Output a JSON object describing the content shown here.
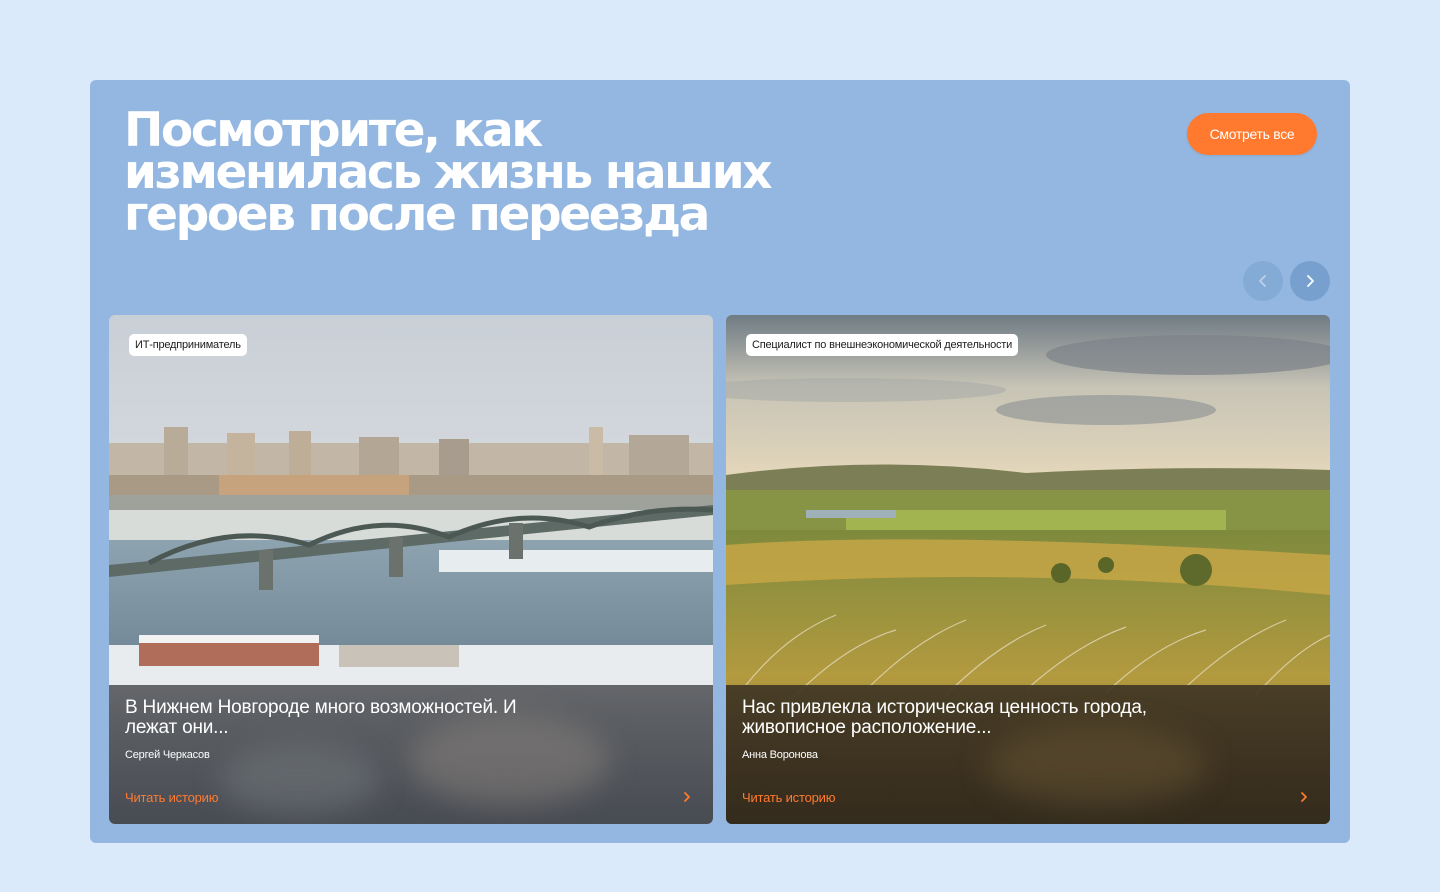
{
  "section": {
    "title": "Посмотрите, как изменилась жизнь наших героев после переезда",
    "see_all_label": "Смотреть все"
  },
  "carousel": {
    "prev_icon": "chevron-left-icon",
    "next_icon": "chevron-right-icon",
    "cards": [
      {
        "tag": "ИТ-предприниматель",
        "title": "В Нижнем Новгороде много возможностей. И лежат они...",
        "author": "Сергей Черкасов",
        "link_label": "Читать историю",
        "image": "city-bridge-winter-photo"
      },
      {
        "tag": "Специалист по внешнеэкономической деятельности",
        "title": "Нас привлекла историческая ценность города, живописное расположение...",
        "author": "Анна Воронова",
        "link_label": "Читать историю",
        "image": "steppe-landscape-photo"
      }
    ]
  },
  "colors": {
    "page_bg": "#dbeafb",
    "panel_bg": "#93b7e0",
    "accent": "#ff7a2e"
  }
}
